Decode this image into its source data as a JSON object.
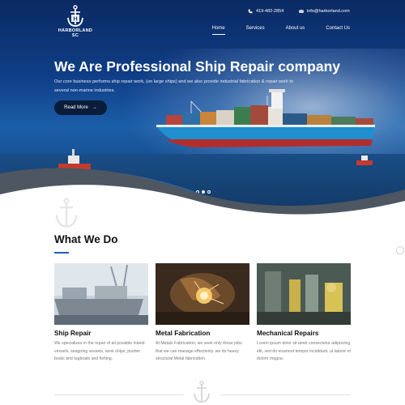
{
  "brand": {
    "name": "HARBORLAND SC"
  },
  "header": {
    "phone": "419-482-2854",
    "email": "info@harborland.com",
    "nav": [
      {
        "label": "Home",
        "active": true
      },
      {
        "label": "Services",
        "active": false
      },
      {
        "label": "About us",
        "active": false
      },
      {
        "label": "Contact Us",
        "active": false
      }
    ]
  },
  "hero": {
    "headline": "We Are Professional Ship Repair company",
    "subtext": "Our core business performs ship repair work, (on large ships) and we also provide industrial fabrication & repair work to several non-marine industries.",
    "button_label": "Read More",
    "button_arrow": "→",
    "slides": 3,
    "active_slide": 2
  },
  "services": {
    "title": "What We Do",
    "items": [
      {
        "title": "Ship Repair",
        "desc": "We specializes in the repair of all possible inland vessels, seagoing vessels, work ships, pusher boats and tugboats and fishing."
      },
      {
        "title": "Metal Fabrication",
        "desc": "At Metals Fabrication, we seek only those jobs that we can manage effectively. we do heavy structural Metal fabrication."
      },
      {
        "title": "Mechanical Repairs",
        "desc": "Lorem ipsum dolor sit amet consectetur adipiscing elit, sed do eiusmod tempor incididunt, ut labore et dolore magna"
      }
    ]
  },
  "colors": {
    "accent": "#1e5fb8",
    "dark": "#0b1c3a",
    "wave_gray": "#5b6470"
  }
}
